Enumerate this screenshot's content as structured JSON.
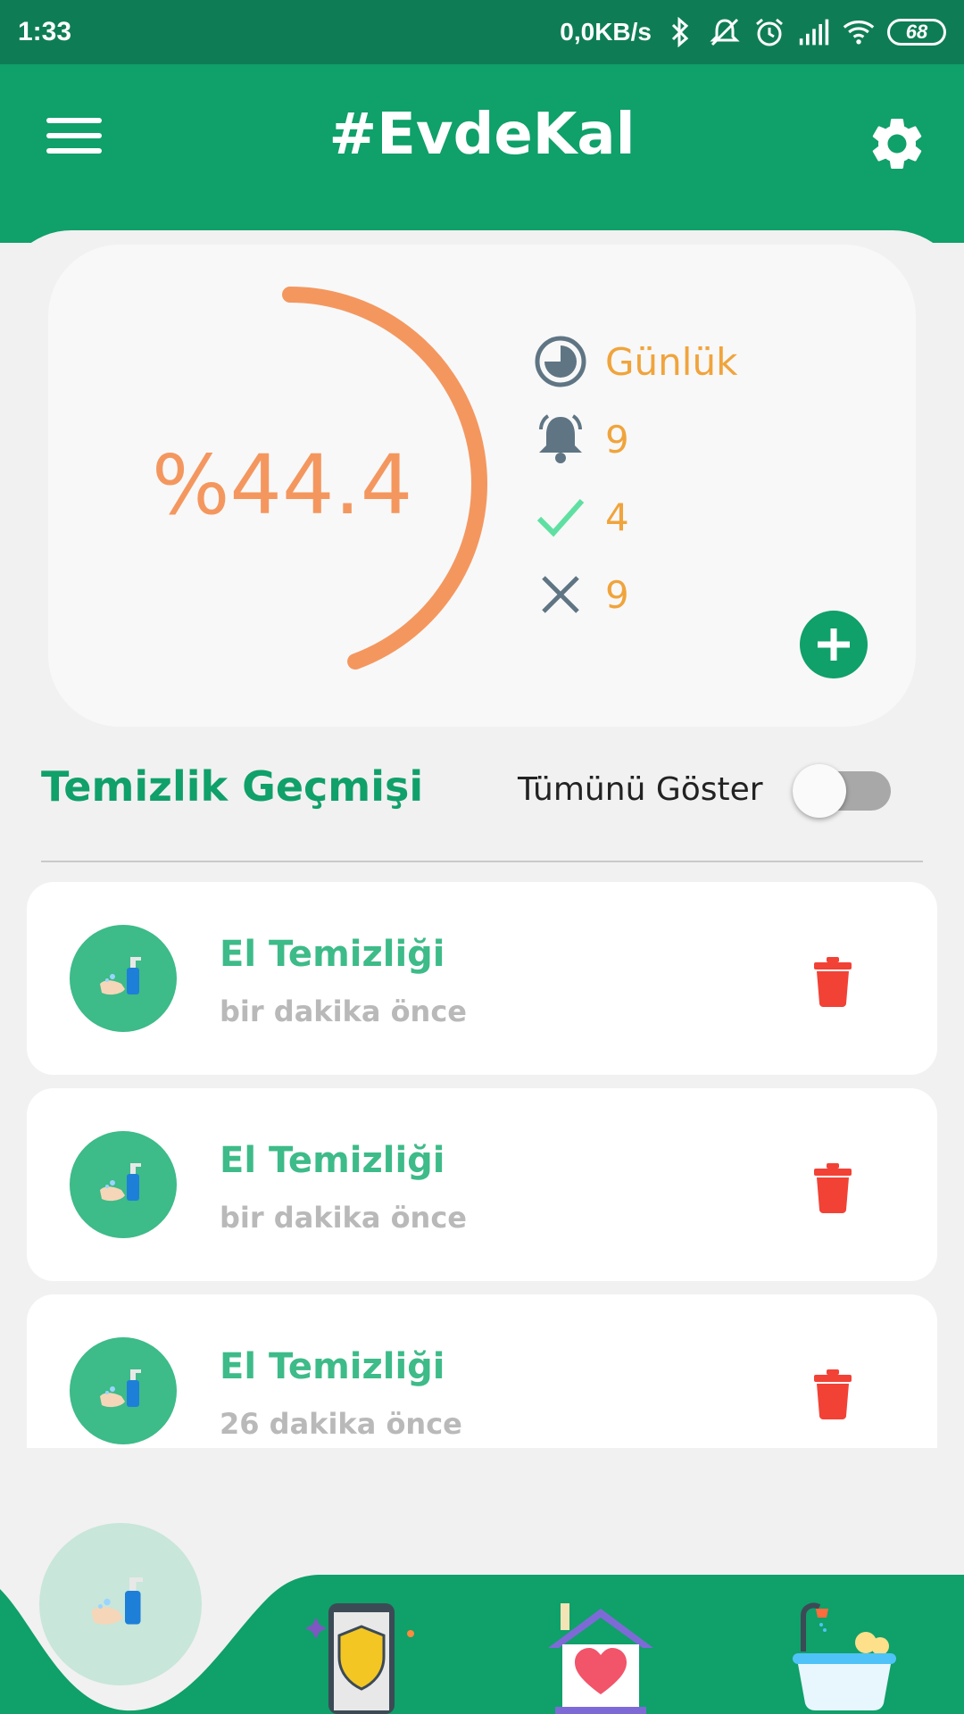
{
  "status_bar": {
    "time": "1:33",
    "network_speed": "0,0KB/s",
    "battery": "68",
    "icons": [
      "bluetooth-icon",
      "mute-icon",
      "alarm-icon",
      "signal-icon",
      "wifi-icon",
      "battery-icon"
    ]
  },
  "header": {
    "title": "#EvdeKal",
    "menu_icon": "menu-icon",
    "settings_icon": "gear-icon"
  },
  "stats": {
    "percent_label": "%44.4",
    "progress": 0.444,
    "period": "Günlük",
    "reminders": "9",
    "done": "4",
    "missed": "9",
    "colors": {
      "ring": "#f4975f",
      "value": "#f0a43c",
      "icon": "#5f7584",
      "check": "#5fe0a2"
    }
  },
  "history": {
    "title": "Temizlik Geçmişi",
    "toggle_label": "Tümünü Göster",
    "show_all": false,
    "items": [
      {
        "title": "El Temizliği",
        "time": "bir dakika önce"
      },
      {
        "title": "El Temizliği",
        "time": "bir dakika önce"
      },
      {
        "title": "El Temizliği",
        "time": "26 dakika önce"
      }
    ]
  },
  "bottom_nav": {
    "items": [
      "hand-wash-icon",
      "phone-shield-icon",
      "house-heart-icon",
      "bathtub-icon"
    ]
  },
  "colors": {
    "primary": "#10a06a",
    "accent": "#3dbb88",
    "delete": "#f24236"
  }
}
